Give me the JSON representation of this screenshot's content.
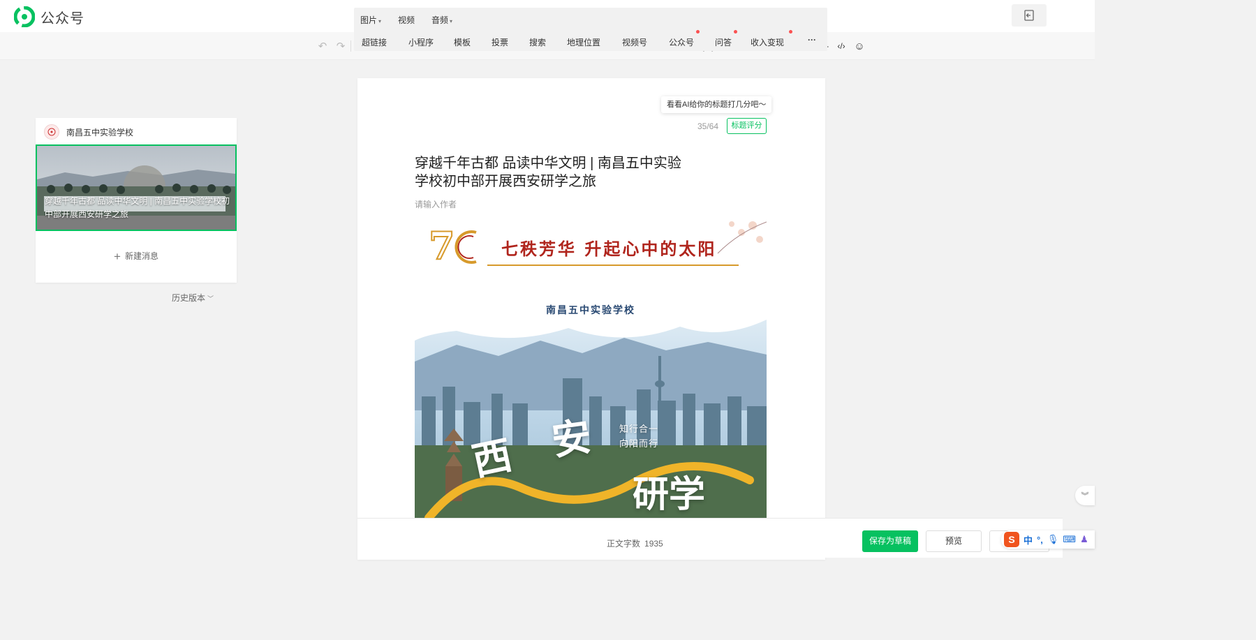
{
  "app": {
    "title": "公众号"
  },
  "insert_menu": {
    "row1": [
      {
        "label": "图片",
        "has_caret": true
      },
      {
        "label": "视频",
        "has_caret": false
      },
      {
        "label": "音频",
        "has_caret": true
      }
    ],
    "row2": [
      {
        "label": "超链接"
      },
      {
        "label": "小程序"
      },
      {
        "label": "模板"
      },
      {
        "label": "投票"
      },
      {
        "label": "搜索"
      },
      {
        "label": "地理位置"
      },
      {
        "label": "视频号"
      },
      {
        "label": "公众号",
        "badge": true
      },
      {
        "label": "问答",
        "badge": true
      },
      {
        "label": "收入变现",
        "badge": true
      }
    ],
    "more": "···"
  },
  "toolbar": {
    "font_size": "16px",
    "icons": [
      "undo-icon",
      "redo-icon",
      "eraser-icon",
      "format-painter-icon",
      "bold-icon",
      "italic-icon",
      "underline-icon",
      "strikethrough-icon",
      "font-color-icon",
      "highlight-icon",
      "align-left-icon",
      "align-center-icon",
      "align-right-icon",
      "list-icon",
      "line-height-icon",
      "indent-icon",
      "letter-spacing-icon",
      "bullet-list-icon",
      "table-icon",
      "quote-icon",
      "divider-icon",
      "code-icon",
      "emoji-icon"
    ],
    "accent": "#07c160"
  },
  "sidebar": {
    "account_name": "南昌五中实验学校",
    "article_title": "穿越千年古都 品读中华文明 | 南昌五中实验学校初中部开展西安研学之旅",
    "new_message": "新建消息",
    "history": "历史版本"
  },
  "editor": {
    "ai_tip": "看看AI给你的标题打几分吧～",
    "title_count": "35/64",
    "score_button": "标题评分",
    "title": "穿越千年古都 品读中华文明 | 南昌五中实验学校初中部开展西安研学之旅",
    "author_placeholder": "请输入作者",
    "banner_text": "七秩芳华 升起心中的太阳",
    "poster": {
      "school": "南昌五中实验学校",
      "word_xi": "西",
      "word_an": "安",
      "slogan_1": "知行合一",
      "slogan_2": "向阳而行",
      "word_yanxue": "研学"
    }
  },
  "footer": {
    "wordcount_label": "正文字数",
    "wordcount_value": "1935",
    "save_draft": "保存为草稿",
    "preview": "预览"
  },
  "ime": {
    "lang": "中"
  }
}
